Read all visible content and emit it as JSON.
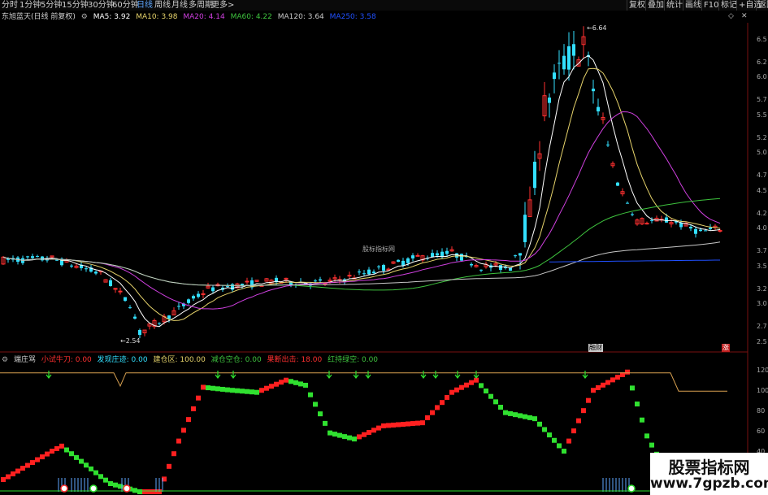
{
  "toolbar": {
    "periods": [
      "分时",
      "1分钟",
      "5分钟",
      "15分钟",
      "30分钟",
      "60分钟",
      "日线",
      "周线",
      "月线",
      "多周期",
      "更多>"
    ],
    "active_period": "日线",
    "right_buttons": [
      "复权",
      "叠加",
      "统计",
      "画线",
      "F10",
      "标记",
      "+自选",
      "返回"
    ]
  },
  "main_legend": {
    "title": "东旭蓝天(日线 前复权)",
    "ma5": "MA5: 3.92",
    "ma10": "MA10: 3.98",
    "ma20": "MA20: 4.14",
    "ma60": "MA60: 4.22",
    "ma120": "MA120: 3.64",
    "ma250": "MA250: 3.58"
  },
  "colors": {
    "up": "#ff3030",
    "down": "#33e0ff",
    "ma5": "#ffffff",
    "ma10": "#e6d36b",
    "ma20": "#d040e0",
    "ma60": "#3ec33e",
    "ma120": "#c8c8c8",
    "ma250": "#2050ff",
    "indicator_up": "#ff2020",
    "indicator_down": "#30e030",
    "orange_line": "#d7a050"
  },
  "annotations": {
    "high": "6.64",
    "low": "2.54",
    "watermark": "股标指标网",
    "fin_tag": "财",
    "up_tag": "涨"
  },
  "y_axis": [
    "6.5",
    "6.2",
    "6.0",
    "5.7",
    "5.5",
    "5.2",
    "5.0",
    "4.7",
    "4.5",
    "4.2",
    "4.0",
    "3.7",
    "3.5",
    "3.2",
    "3.0",
    "2.7",
    "2.5"
  ],
  "indicator_legend": {
    "name": "端庄骂",
    "i1": "小试牛刀: 0.00",
    "i2": "发现庄迹: 0.00",
    "i3": "建仓区: 100.00",
    "i4": "减仓空仓: 0.00",
    "i5": "果断出击: 18.00",
    "i6": "红持绿空: 0.00"
  },
  "indicator_axis": [
    "120",
    "100",
    "80",
    "60",
    "40",
    "20"
  ],
  "brand": {
    "line1": "股票指标网",
    "line2": "www.7gpzb.com"
  },
  "chart_data": {
    "type": "candlestick",
    "high_label": 6.64,
    "low_label": 2.54,
    "ylim": [
      2.4,
      6.7
    ],
    "indicator_ylim": [
      0,
      125
    ]
  }
}
